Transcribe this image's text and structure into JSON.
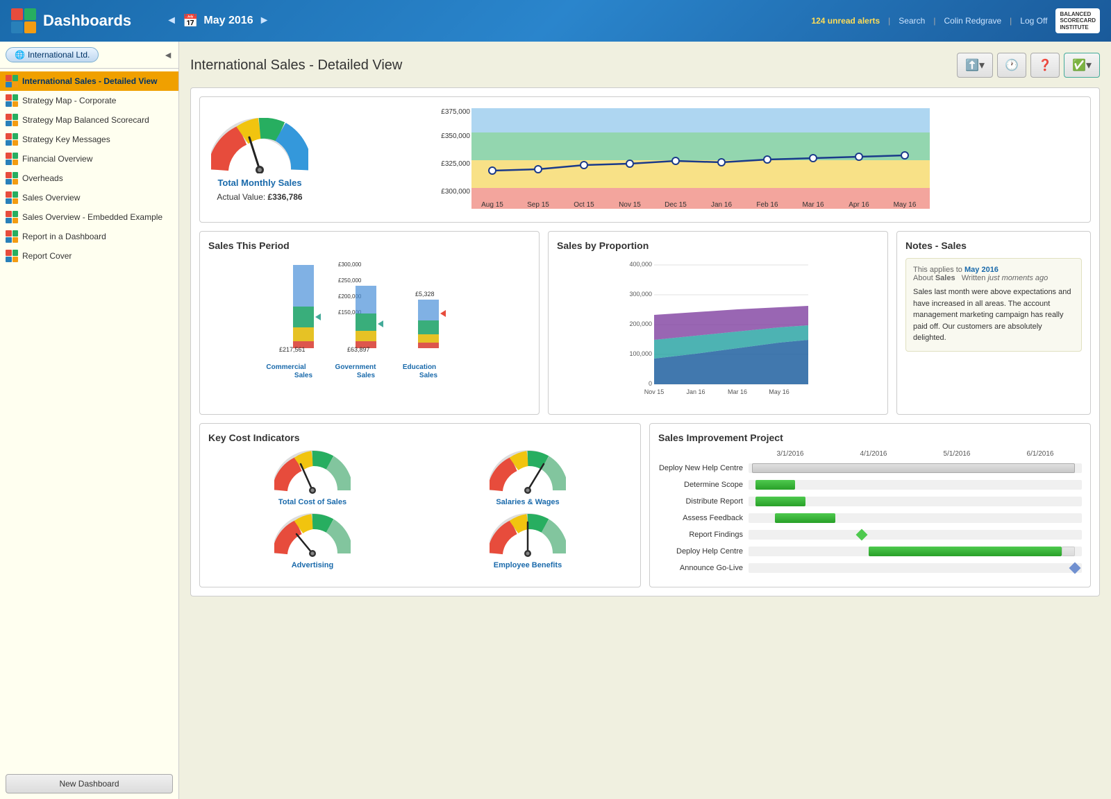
{
  "header": {
    "title": "Dashboards",
    "alerts": "124 unread alerts",
    "search": "Search",
    "user": "Colin Redgrave",
    "logout": "Log Off",
    "nav_prev": "◄",
    "nav_next": "►",
    "nav_date": "May 2016",
    "nav_date_icon": "📅"
  },
  "sidebar": {
    "org_label": "International Ltd.",
    "items": [
      {
        "label": "International Sales - Detailed View",
        "active": true
      },
      {
        "label": "Strategy Map - Corporate",
        "active": false
      },
      {
        "label": "Strategy Map Balanced Scorecard",
        "active": false
      },
      {
        "label": "Strategy Key Messages",
        "active": false
      },
      {
        "label": "Financial Overview",
        "active": false
      },
      {
        "label": "Overheads",
        "active": false
      },
      {
        "label": "Sales Overview",
        "active": false
      },
      {
        "label": "Sales Overview - Embedded Example",
        "active": false
      },
      {
        "label": "Report in a Dashboard",
        "active": false
      },
      {
        "label": "Report Cover",
        "active": false
      }
    ],
    "new_dashboard_label": "New Dashboard"
  },
  "main": {
    "title": "International Sales - Detailed View",
    "top_chart": {
      "gauge_label": "Total Monthly Sales",
      "gauge_sublabel": "Actual Value:",
      "gauge_value": "£336,786",
      "y_labels": [
        "£375,000",
        "£350,000",
        "£325,000",
        "£300,000"
      ],
      "x_labels": [
        "Aug 15",
        "Sep 15",
        "Oct 15",
        "Nov 15",
        "Dec 15",
        "Jan 16",
        "Feb 16",
        "Mar 16",
        "Apr 16",
        "May 16"
      ]
    },
    "sales_this_period": {
      "title": "Sales This Period",
      "bars": [
        {
          "label": "Commercial\nSales",
          "value": "£217,561"
        },
        {
          "label": "Government\nSales",
          "value": "£63,897"
        },
        {
          "label": "Education\nSales",
          "value": "£5,328"
        }
      ]
    },
    "sales_proportion": {
      "title": "Sales by Proportion",
      "y_labels": [
        "400,000",
        "300,000",
        "200,000",
        "100,000",
        "0"
      ],
      "x_labels": [
        "Nov 15",
        "Jan 16",
        "Mar 16",
        "May 16"
      ]
    },
    "notes": {
      "title": "Notes - Sales",
      "applies_to": "This applies to",
      "period": "May 2016",
      "about": "About",
      "about_topic": "Sales",
      "written": "Written",
      "written_when": "just moments ago",
      "body": "Sales last month were above expectations and have increased in all areas. The account management marketing campaign has really paid off. Our customers are absolutely delighted."
    },
    "key_cost": {
      "title": "Key Cost Indicators",
      "gauges": [
        {
          "label": "Total Cost of Sales"
        },
        {
          "label": "Salaries & Wages"
        },
        {
          "label": "Advertising"
        },
        {
          "label": "Employee Benefits"
        }
      ]
    },
    "improvement": {
      "title": "Sales Improvement Project",
      "col_labels": [
        "3/1/2016",
        "4/1/2016",
        "5/1/2016",
        "6/1/2016"
      ],
      "tasks": [
        {
          "label": "Deploy New Help Centre",
          "type": "gray",
          "start": 0,
          "width": 1.0
        },
        {
          "label": "Determine Scope",
          "type": "green",
          "start": 0.02,
          "width": 0.12
        },
        {
          "label": "Distribute Report",
          "type": "green",
          "start": 0.02,
          "width": 0.15
        },
        {
          "label": "Assess Feedback",
          "type": "green",
          "start": 0.08,
          "width": 0.18
        },
        {
          "label": "Report Findings",
          "type": "diamond",
          "start": 0.34,
          "width": 0
        },
        {
          "label": "Deploy Help Centre",
          "type": "green",
          "start": 0.36,
          "width": 0.57
        },
        {
          "label": "Announce Go-Live",
          "type": "diamond-blue",
          "start": 0.99,
          "width": 0
        }
      ]
    }
  }
}
